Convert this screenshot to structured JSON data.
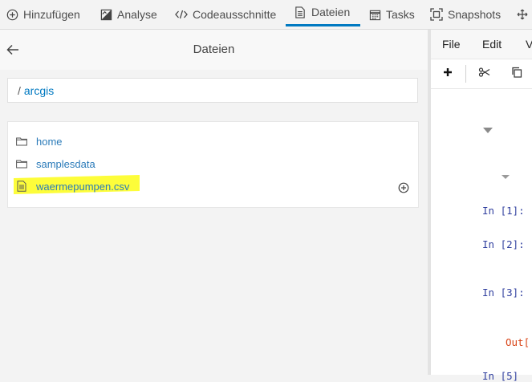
{
  "toolbar": {
    "add_label": "Hinzufügen",
    "analyse_label": "Analyse",
    "snippets_label": "Codeausschnitte",
    "files_label": "Dateien",
    "tasks_label": "Tasks",
    "snapshots_label": "Snapshots"
  },
  "files_panel": {
    "title": "Dateien",
    "path_root": "/",
    "path_folder": "arcgis",
    "items": [
      {
        "label": "home",
        "type": "folder"
      },
      {
        "label": "samplesdata",
        "type": "folder"
      },
      {
        "label": "waermepumpen.csv",
        "type": "file",
        "highlighted": true
      }
    ]
  },
  "notebook": {
    "menu": {
      "file": "File",
      "edit": "Edit",
      "view": "V"
    },
    "prompts": [
      "In [1]:",
      "In [2]:",
      "In [3]:",
      "Out[",
      "In [5]"
    ]
  },
  "colors": {
    "accent": "#0079c1",
    "highlight": "#fdfd3a",
    "prompt_in": "#303f9f",
    "prompt_out": "#d84315"
  }
}
